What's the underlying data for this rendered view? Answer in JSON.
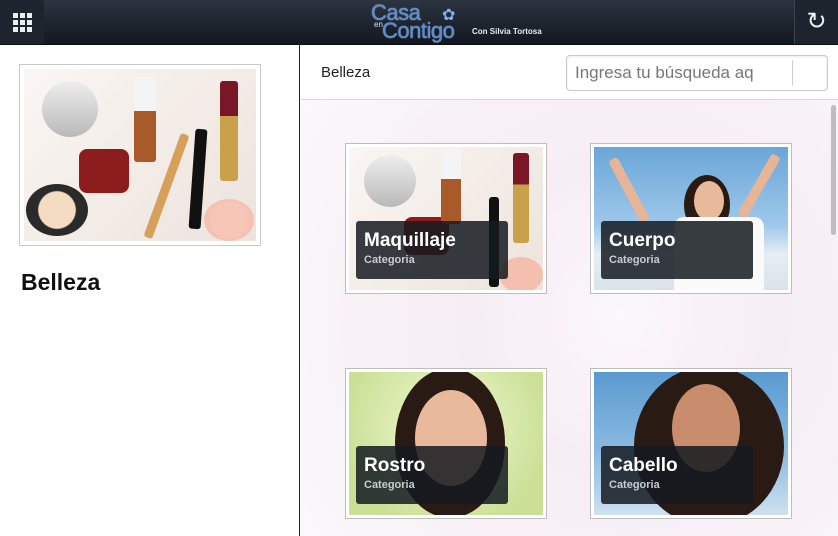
{
  "header": {
    "logo_casa": "Casa",
    "logo_en": "en",
    "logo_contigo": "Contigo",
    "logo_subtitle": "Con Silvia Tortosa",
    "menu_icon": "grid-icon",
    "refresh_icon": "refresh-icon"
  },
  "left": {
    "title": "Belleza"
  },
  "toolbar": {
    "title": "Belleza",
    "search_placeholder": "Ingresa tu búsqueda aq"
  },
  "tiles": [
    {
      "name": "Maquillaje",
      "type": "Categoria"
    },
    {
      "name": "Cuerpo",
      "type": "Categoria"
    },
    {
      "name": "Rostro",
      "type": "Categoria"
    },
    {
      "name": "Cabello",
      "type": "Categoria"
    }
  ],
  "colors": {
    "topbar": "#1a212b",
    "accent_logo": "#5a8fd6",
    "caption_bg": "#141a20"
  }
}
